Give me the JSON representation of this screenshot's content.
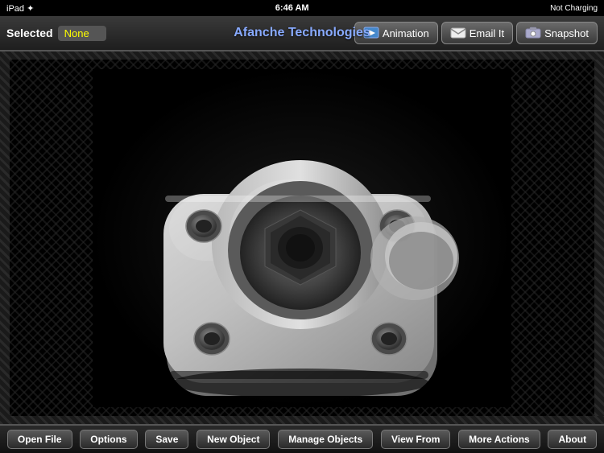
{
  "status_bar": {
    "left": "iPad ✦",
    "time": "6:46 AM",
    "right": "Not Charging"
  },
  "toolbar": {
    "selected_label": "Selected",
    "selected_value": "None",
    "title": "Afanche Technologies",
    "animation_label": "Animation",
    "email_label": "Email It",
    "snapshot_label": "Snapshot"
  },
  "bottom_bar": {
    "open_file": "Open File",
    "options": "Options",
    "save": "Save",
    "new_object": "New Object",
    "manage_objects": "Manage Objects",
    "view_from": "View From",
    "more_actions": "More Actions",
    "about": "About"
  }
}
